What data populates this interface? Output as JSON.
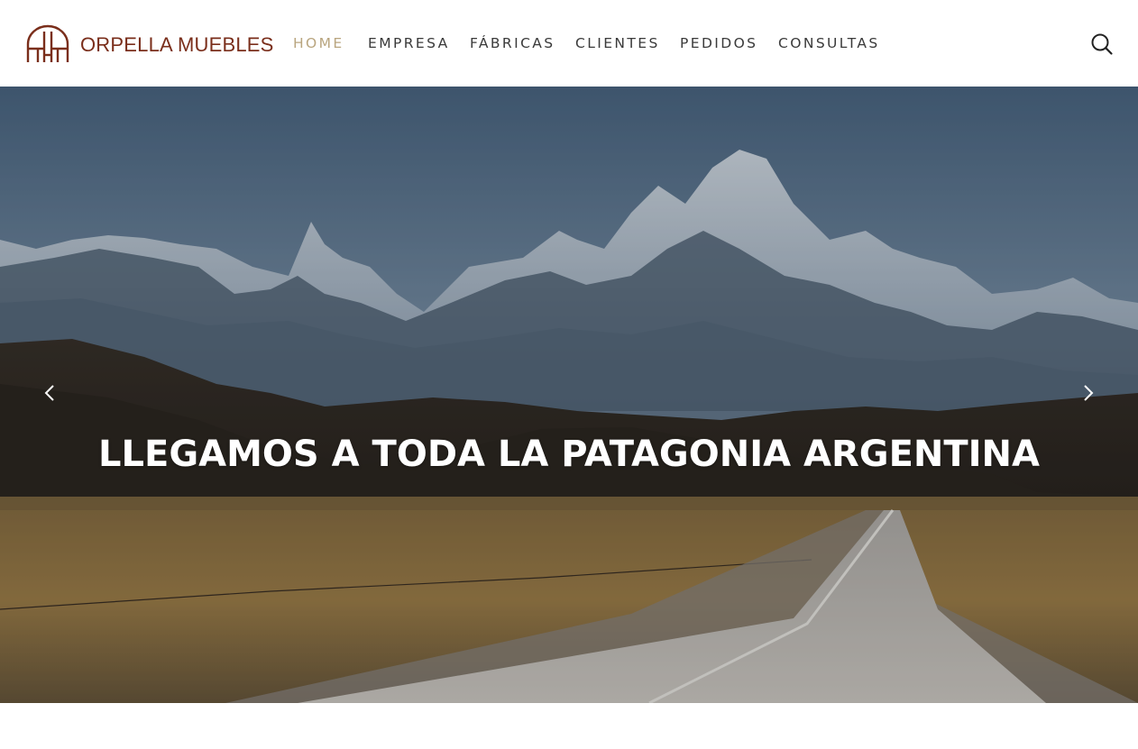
{
  "header": {
    "brand_name": "ORPELLA MUEBLES",
    "brand_color": "#7a2e1b",
    "logo_icon": "orpella-logo-icon",
    "nav": [
      {
        "label": "HOME",
        "active": true
      },
      {
        "label": "EMPRESA",
        "active": false
      },
      {
        "label": "FÁBRICAS",
        "active": false
      },
      {
        "label": "CLIENTES",
        "active": false
      },
      {
        "label": "PEDIDOS",
        "active": false
      },
      {
        "label": "CONSULTAS",
        "active": false
      }
    ],
    "active_color": "#b9a57f",
    "search_icon": "search-icon"
  },
  "hero": {
    "title": "LLEGAMOS A TODA LA PATAGONIA ARGENTINA",
    "prev_icon": "chevron-left-icon",
    "next_icon": "chevron-right-icon",
    "image": "patagonia-road-mountains"
  }
}
